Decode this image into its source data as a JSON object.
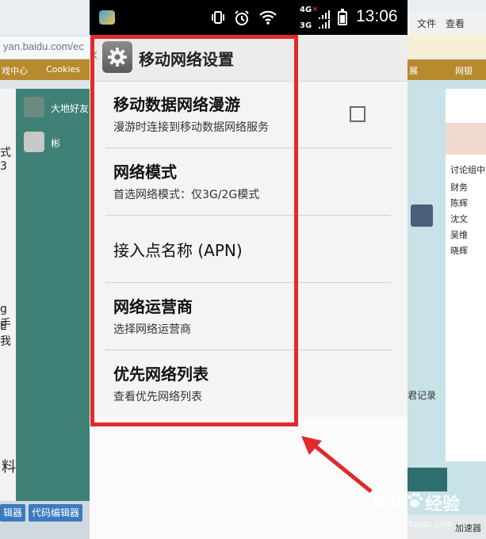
{
  "background": {
    "url_fragment": "yan.baidu.com/ec",
    "bookmarks_left": [
      "戏中心",
      "Cookies"
    ],
    "left_contacts": [
      "大地好友",
      "彬"
    ],
    "left_strip_text": [
      "式3",
      "g手",
      "E我"
    ],
    "left_bottom_label": "料",
    "bottom_tabs": [
      "辑器",
      "代码编辑器"
    ],
    "right_menu": [
      "文件",
      "查看"
    ],
    "right_bookbar": [
      "展",
      "网银"
    ],
    "right_discussion": [
      "讨论组中",
      "财务",
      "陈辉",
      "沈文",
      "吴维",
      "晓辉"
    ],
    "right_record": "君记录",
    "right_bottom": "加速器"
  },
  "statusbar": {
    "net_top": "4G",
    "net_bottom": "3G",
    "time": "13:06"
  },
  "titlebar": {
    "title": "移动网络设置",
    "icon": "gear-icon"
  },
  "settings": [
    {
      "title": "移动数据网络漫游",
      "summary": "漫游时连接到移动数据网络服务",
      "checkbox": true,
      "checked": false
    },
    {
      "title": "网络模式",
      "summary": "首选网络模式：仅3G/2G模式"
    },
    {
      "title": "接入点名称 (APN)",
      "summary": ""
    },
    {
      "title": "网络运营商",
      "summary": "选择网络运营商"
    },
    {
      "title": "优先网络列表",
      "summary": "查看优先网络列表"
    }
  ],
  "annotation": {
    "box_color": "#e12a2a",
    "arrow": "red-arrow"
  },
  "watermark": {
    "logo": "Bai",
    "text": "经验",
    "url": "jingyan.baidu.com"
  }
}
